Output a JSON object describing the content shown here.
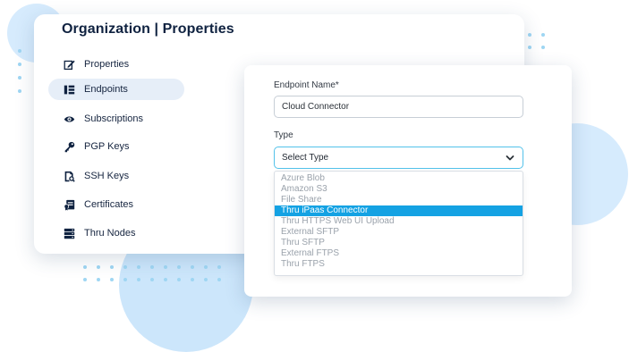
{
  "organization": {
    "title": "Organization | Properties"
  },
  "nav": {
    "items": [
      {
        "label": "Properties",
        "icon": "edit-icon",
        "active": false
      },
      {
        "label": "Endpoints",
        "icon": "endpoints-icon",
        "active": true
      },
      {
        "label": "Subscriptions",
        "icon": "eye-icon",
        "active": false
      },
      {
        "label": "PGP Keys",
        "icon": "key-icon",
        "active": false
      },
      {
        "label": "SSH Keys",
        "icon": "document-key-icon",
        "active": false
      },
      {
        "label": "Certificates",
        "icon": "certificate-icon",
        "active": false
      },
      {
        "label": "Thru Nodes",
        "icon": "server-icon",
        "active": false
      }
    ]
  },
  "form": {
    "endpoint_name_label": "Endpoint Name*",
    "endpoint_name_value": "Cloud Connector",
    "type_label": "Type",
    "type_selected": "Select Type",
    "type_options": [
      {
        "label": "Azure Blob",
        "highlighted": false
      },
      {
        "label": "Amazon S3",
        "highlighted": false
      },
      {
        "label": "File Share",
        "highlighted": false
      },
      {
        "label": "Thru iPaas Connector",
        "highlighted": true
      },
      {
        "label": "Thru HTTPS Web UI Upload",
        "highlighted": false
      },
      {
        "label": "External SFTP",
        "highlighted": false
      },
      {
        "label": "Thru SFTP",
        "highlighted": false
      },
      {
        "label": "External FTPS",
        "highlighted": false
      },
      {
        "label": "Thru FTPS",
        "highlighted": false
      }
    ]
  },
  "colors": {
    "accent": "#14a2e3",
    "title": "#0f2240",
    "active_nav_bg": "#e6eef8",
    "decor_circle": "#dcefff"
  }
}
